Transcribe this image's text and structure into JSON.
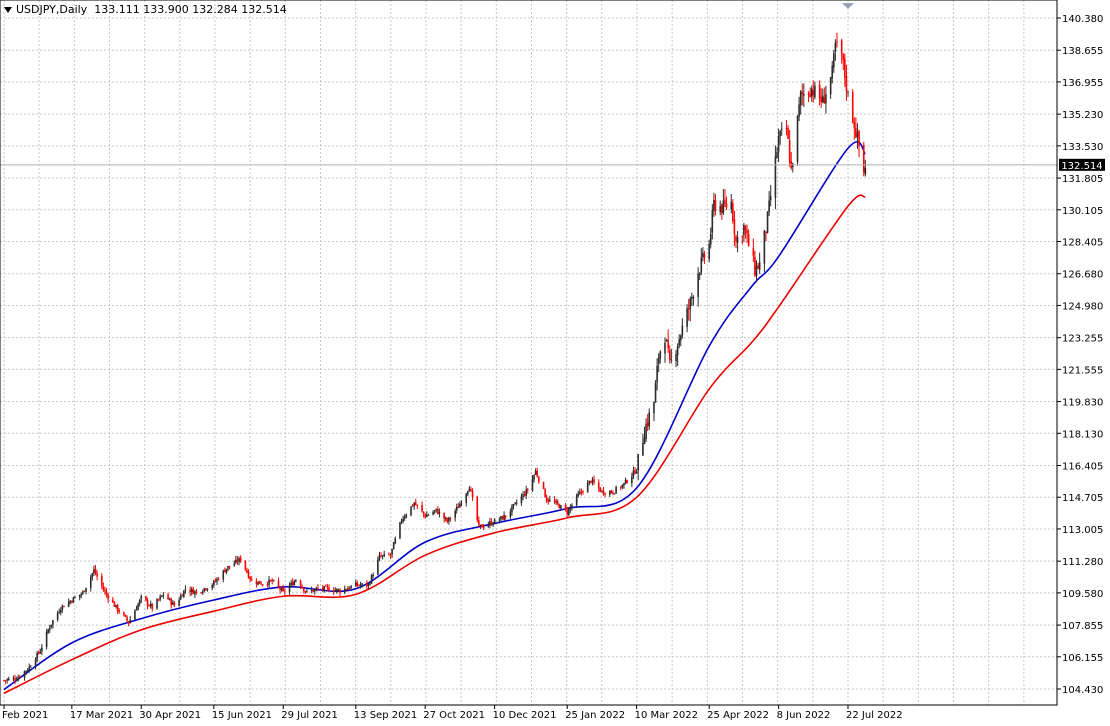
{
  "header": {
    "symbol": "USDJPY,Daily",
    "open": "133.111",
    "high": "133.900",
    "low": "132.284",
    "close": "132.514"
  },
  "colors": {
    "bull": "#2b2b2b",
    "bear": "#ff0000",
    "ma_fast": "#0000cc",
    "ma_slow": "#ee0000",
    "grid": "#c8c8c8",
    "price_line": "#b0b0b0"
  },
  "chart_data": {
    "type": "candlestick",
    "grid": true,
    "y_ticks": [
      "140.380",
      "138.655",
      "136.955",
      "135.230",
      "133.530",
      "131.805",
      "130.105",
      "128.405",
      "126.680",
      "124.980",
      "123.255",
      "121.555",
      "119.830",
      "118.130",
      "116.405",
      "114.705",
      "113.005",
      "111.280",
      "109.580",
      "107.855",
      "106.155",
      "104.430"
    ],
    "x_ticks": [
      "2 Feb 2021",
      "17 Mar 2021",
      "30 Apr 2021",
      "15 Jun 2021",
      "29 Jul 2021",
      "13 Sep 2021",
      "27 Oct 2021",
      "10 Dec 2021",
      "25 Jan 2022",
      "10 Mar 2022",
      "25 Apr 2022",
      "8 Jun 2022",
      "22 Jul 2022"
    ],
    "x_tick_labels_shown": [
      "Feb 2021",
      "17 Mar 2021",
      "30 Apr 2021",
      "15 Jun 2021",
      "29 Jul 2021",
      "13 Sep 2021",
      "27 Oct 2021",
      "10 Dec 2021",
      "25 Jan 2022",
      "10 Mar 2022",
      "25 Apr 2022",
      "8 Jun 2022",
      "22 Jul 2022"
    ],
    "ylim": [
      103.6,
      141.2
    ],
    "current_price": "132.514",
    "close_path": [
      [
        "2 Feb 2021",
        104.9
      ],
      [
        "10 Feb 2021",
        105.0
      ],
      [
        "18 Feb 2021",
        105.6
      ],
      [
        "25 Feb 2021",
        106.5
      ],
      [
        "3 Mar 2021",
        107.8
      ],
      [
        "10 Mar 2021",
        108.8
      ],
      [
        "17 Mar 2021",
        109.2
      ],
      [
        "24 Mar 2021",
        109.6
      ],
      [
        "31 Mar 2021",
        110.8
      ],
      [
        "7 Apr 2021",
        109.6
      ],
      [
        "14 Apr 2021",
        108.8
      ],
      [
        "22 Apr 2021",
        108.0
      ],
      [
        "30 Apr 2021",
        109.3
      ],
      [
        "7 May 2021",
        108.8
      ],
      [
        "14 May 2021",
        109.5
      ],
      [
        "21 May 2021",
        108.9
      ],
      [
        "28 May 2021",
        109.8
      ],
      [
        "4 Jun 2021",
        109.6
      ],
      [
        "15 Jun 2021",
        110.1
      ],
      [
        "23 Jun 2021",
        110.9
      ],
      [
        "2 Jul 2021",
        111.4
      ],
      [
        "9 Jul 2021",
        110.2
      ],
      [
        "16 Jul 2021",
        110.1
      ],
      [
        "22 Jul 2021",
        110.2
      ],
      [
        "29 Jul 2021",
        109.6
      ],
      [
        "6 Aug 2021",
        110.3
      ],
      [
        "13 Aug 2021",
        109.6
      ],
      [
        "20 Aug 2021",
        109.8
      ],
      [
        "27 Aug 2021",
        109.8
      ],
      [
        "3 Sep 2021",
        109.7
      ],
      [
        "13 Sep 2021",
        110.0
      ],
      [
        "21 Sep 2021",
        110.0
      ],
      [
        "28 Sep 2021",
        111.5
      ],
      [
        "5 Oct 2021",
        111.6
      ],
      [
        "12 Oct 2021",
        113.5
      ],
      [
        "20 Oct 2021",
        114.4
      ],
      [
        "27 Oct 2021",
        113.7
      ],
      [
        "3 Nov 2021",
        114.0
      ],
      [
        "10 Nov 2021",
        113.4
      ],
      [
        "17 Nov 2021",
        114.2
      ],
      [
        "24 Nov 2021",
        115.3
      ],
      [
        "30 Nov 2021",
        113.1
      ],
      [
        "10 Dec 2021",
        113.4
      ],
      [
        "17 Dec 2021",
        113.7
      ],
      [
        "24 Dec 2021",
        114.4
      ],
      [
        "31 Dec 2021",
        115.1
      ],
      [
        "5 Jan 2022",
        116.1
      ],
      [
        "12 Jan 2022",
        114.6
      ],
      [
        "19 Jan 2022",
        114.3
      ],
      [
        "25 Jan 2022",
        113.9
      ],
      [
        "1 Feb 2022",
        114.8
      ],
      [
        "9 Feb 2022",
        115.6
      ],
      [
        "16 Feb 2022",
        115.0
      ],
      [
        "23 Feb 2022",
        115.0
      ],
      [
        "2 Mar 2022",
        115.4
      ],
      [
        "10 Mar 2022",
        116.2
      ],
      [
        "15 Mar 2022",
        118.3
      ],
      [
        "21 Mar 2022",
        119.8
      ],
      [
        "24 Mar 2022",
        122.3
      ],
      [
        "28 Mar 2022",
        123.4
      ],
      [
        "31 Mar 2022",
        121.7
      ],
      [
        "7 Apr 2022",
        123.5
      ],
      [
        "13 Apr 2022",
        125.1
      ],
      [
        "18 Apr 2022",
        126.8
      ],
      [
        "25 Apr 2022",
        128.2
      ],
      [
        "28 Apr 2022",
        130.4
      ],
      [
        "4 May 2022",
        130.2
      ],
      [
        "9 May 2022",
        130.5
      ],
      [
        "12 May 2022",
        128.4
      ],
      [
        "17 May 2022",
        129.2
      ],
      [
        "24 May 2022",
        126.9
      ],
      [
        "27 May 2022",
        127.2
      ],
      [
        "1 Jun 2022",
        129.6
      ],
      [
        "8 Jun 2022",
        133.9
      ],
      [
        "13 Jun 2022",
        134.4
      ],
      [
        "16 Jun 2022",
        132.2
      ],
      [
        "22 Jun 2022",
        136.2
      ],
      [
        "29 Jun 2022",
        136.6
      ],
      [
        "6 Jul 2022",
        135.9
      ],
      [
        "12 Jul 2022",
        137.4
      ],
      [
        "14 Jul 2022",
        138.9
      ],
      [
        "18 Jul 2022",
        138.4
      ],
      [
        "22 Jul 2022",
        136.2
      ],
      [
        "27 Jul 2022",
        134.3
      ],
      [
        "29 Jul 2022",
        133.5
      ],
      [
        "1 Aug 2022",
        132.1
      ],
      [
        "2 Aug 2022",
        132.5
      ]
    ],
    "series": [
      {
        "style": "blue-ma",
        "values": [
          [
            "2 Feb 2021",
            104.4
          ],
          [
            "17 Mar 2021",
            106.9
          ],
          [
            "30 Apr 2021",
            108.2
          ],
          [
            "15 Jun 2021",
            109.2
          ],
          [
            "29 Jul 2021",
            109.9
          ],
          [
            "13 Sep 2021",
            109.8
          ],
          [
            "27 Oct 2021",
            112.3
          ],
          [
            "10 Dec 2021",
            113.3
          ],
          [
            "25 Jan 2022",
            114.1
          ],
          [
            "10 Mar 2022",
            115.2
          ],
          [
            "25 Apr 2022",
            122.8
          ],
          [
            "22 May 2022",
            126.0
          ],
          [
            "8 Jun 2022",
            127.6
          ],
          [
            "22 Jul 2022",
            133.4
          ],
          [
            "2 Aug 2022",
            133.1
          ]
        ]
      },
      {
        "style": "red-ma",
        "values": [
          [
            "2 Feb 2021",
            104.2
          ],
          [
            "17 Mar 2021",
            106.0
          ],
          [
            "30 Apr 2021",
            107.6
          ],
          [
            "15 Jun 2021",
            108.6
          ],
          [
            "29 Jul 2021",
            109.4
          ],
          [
            "13 Sep 2021",
            109.5
          ],
          [
            "27 Oct 2021",
            111.6
          ],
          [
            "10 Dec 2021",
            112.8
          ],
          [
            "25 Jan 2022",
            113.6
          ],
          [
            "10 Mar 2022",
            114.7
          ],
          [
            "25 Apr 2022",
            120.5
          ],
          [
            "22 May 2022",
            123.0
          ],
          [
            "8 Jun 2022",
            124.9
          ],
          [
            "22 Jul 2022",
            130.3
          ],
          [
            "2 Aug 2022",
            130.8
          ]
        ]
      }
    ]
  }
}
